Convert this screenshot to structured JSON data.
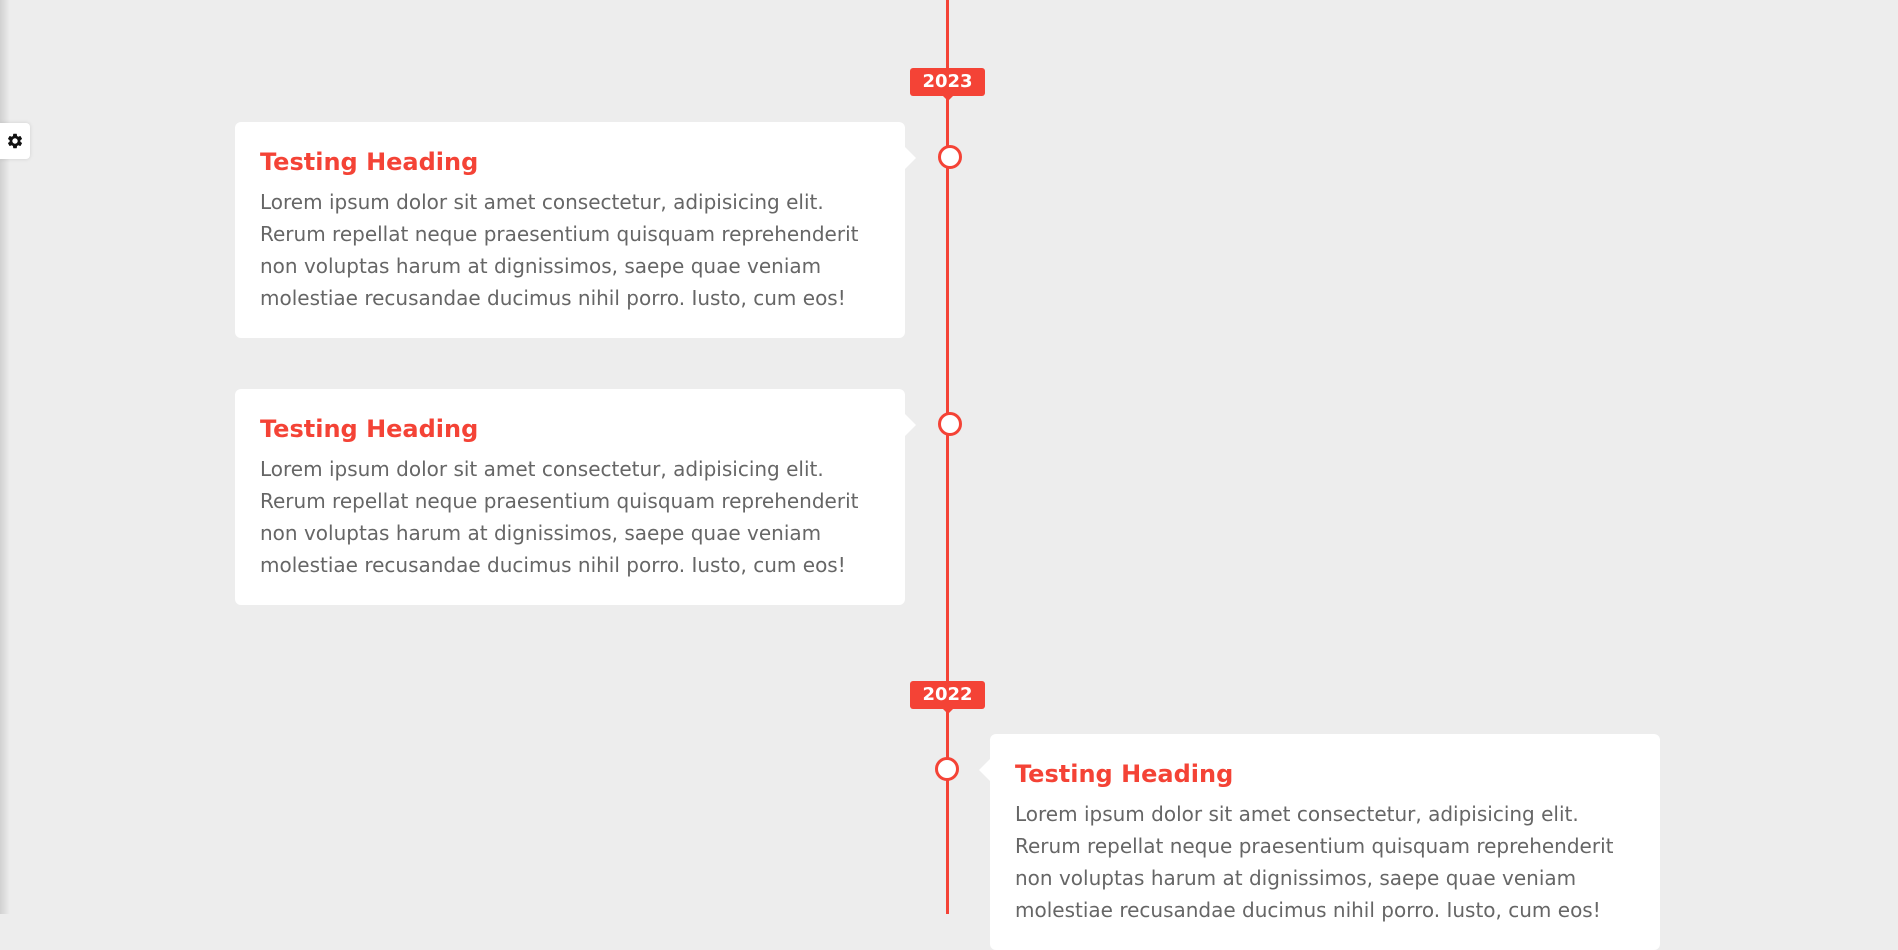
{
  "colors": {
    "accent": "#f44336",
    "background": "#ededed",
    "card": "#ffffff",
    "body_text": "#666666"
  },
  "settings": {
    "icon": "gear-icon"
  },
  "timeline": {
    "years": [
      {
        "label": "2023"
      },
      {
        "label": "2022"
      }
    ],
    "entries": [
      {
        "title": "Testing Heading",
        "text": "Lorem ipsum dolor sit amet consectetur, adipisicing elit. Rerum repellat neque praesentium quisquam reprehenderit non voluptas harum at dignissimos, saepe quae veniam molestiae recusandae ducimus nihil porro. Iusto, cum eos!"
      },
      {
        "title": "Testing Heading",
        "text": "Lorem ipsum dolor sit amet consectetur, adipisicing elit. Rerum repellat neque praesentium quisquam reprehenderit non voluptas harum at dignissimos, saepe quae veniam molestiae recusandae ducimus nihil porro. Iusto, cum eos!"
      },
      {
        "title": "Testing Heading",
        "text": "Lorem ipsum dolor sit amet consectetur, adipisicing elit. Rerum repellat neque praesentium quisquam reprehenderit non voluptas harum at dignissimos, saepe quae veniam molestiae recusandae ducimus nihil porro. Iusto, cum eos!"
      }
    ]
  }
}
